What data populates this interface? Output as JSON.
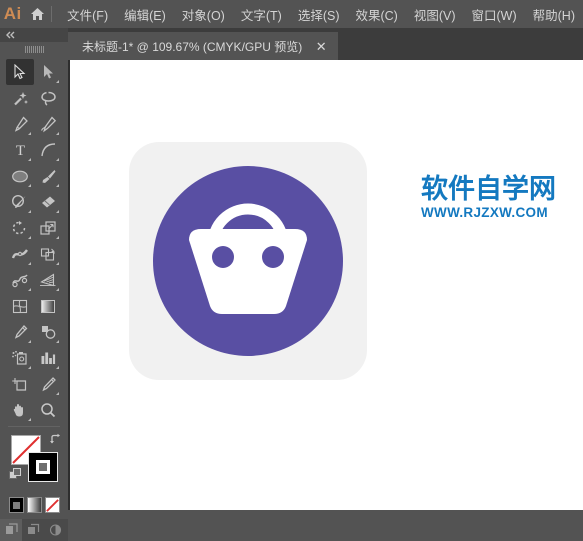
{
  "app": {
    "logo_text": "Ai",
    "home_icon": "home-icon",
    "accent_orange": "#cf8c54",
    "chrome_bg": "#535353"
  },
  "menubar": {
    "items": [
      {
        "label": "文件(F)",
        "name": "menu-file"
      },
      {
        "label": "编辑(E)",
        "name": "menu-edit"
      },
      {
        "label": "对象(O)",
        "name": "menu-object"
      },
      {
        "label": "文字(T)",
        "name": "menu-type"
      },
      {
        "label": "选择(S)",
        "name": "menu-select"
      },
      {
        "label": "效果(C)",
        "name": "menu-effect"
      },
      {
        "label": "视图(V)",
        "name": "menu-view"
      },
      {
        "label": "窗口(W)",
        "name": "menu-window"
      },
      {
        "label": "帮助(H)",
        "name": "menu-help"
      }
    ]
  },
  "tabbar": {
    "tab_title": "未标题-1* @ 109.67% (CMYK/GPU 预览)",
    "close_label": "✕",
    "document_name": "未标题-1",
    "modified_marker": "*",
    "zoom_level": "109.67%",
    "color_mode": "CMYK",
    "renderer": "GPU",
    "view_mode": "预览"
  },
  "toolbar": {
    "collapse_label": "◄◄",
    "tools": [
      {
        "name": "selection-tool",
        "label": "选择工具",
        "active": true,
        "corner": false
      },
      {
        "name": "direct-selection-tool",
        "label": "直接选择工具",
        "active": false,
        "corner": true
      },
      {
        "name": "magic-wand-tool",
        "label": "魔棒工具",
        "active": false,
        "corner": false
      },
      {
        "name": "lasso-tool",
        "label": "套索工具",
        "active": false,
        "corner": false
      },
      {
        "name": "pen-tool",
        "label": "钢笔工具",
        "active": false,
        "corner": true
      },
      {
        "name": "curvature-tool",
        "label": "曲率工具",
        "active": false,
        "corner": true
      },
      {
        "name": "type-tool",
        "label": "文字工具",
        "active": false,
        "corner": true
      },
      {
        "name": "line-segment-tool",
        "label": "直线段工具",
        "active": false,
        "corner": true
      },
      {
        "name": "ellipse-tool",
        "label": "椭圆工具",
        "active": false,
        "corner": true
      },
      {
        "name": "paintbrush-tool",
        "label": "画笔工具",
        "active": false,
        "corner": true
      },
      {
        "name": "shaper-tool",
        "label": "Shaper 工具",
        "active": false,
        "corner": true
      },
      {
        "name": "eraser-tool",
        "label": "橡皮擦工具",
        "active": false,
        "corner": true
      },
      {
        "name": "rotate-tool",
        "label": "旋转工具",
        "active": false,
        "corner": true
      },
      {
        "name": "scale-tool",
        "label": "比例缩放工具",
        "active": false,
        "corner": true
      },
      {
        "name": "width-tool",
        "label": "宽度工具",
        "active": false,
        "corner": true
      },
      {
        "name": "free-transform-tool",
        "label": "自由变换工具",
        "active": false,
        "corner": true
      },
      {
        "name": "shape-builder-tool",
        "label": "形状生成器工具",
        "active": false,
        "corner": true
      },
      {
        "name": "perspective-grid-tool",
        "label": "透视网格工具",
        "active": false,
        "corner": true
      },
      {
        "name": "mesh-tool",
        "label": "网格工具",
        "active": false,
        "corner": false
      },
      {
        "name": "gradient-tool",
        "label": "渐变工具",
        "active": false,
        "corner": false
      },
      {
        "name": "eyedropper-tool",
        "label": "吸管工具",
        "active": false,
        "corner": true
      },
      {
        "name": "blend-tool",
        "label": "混合工具",
        "active": false,
        "corner": true
      },
      {
        "name": "symbol-sprayer-tool",
        "label": "符号喷枪工具",
        "active": false,
        "corner": true
      },
      {
        "name": "column-graph-tool",
        "label": "柱形图工具",
        "active": false,
        "corner": true
      },
      {
        "name": "artboard-tool",
        "label": "画板工具",
        "active": false,
        "corner": false
      },
      {
        "name": "slice-tool",
        "label": "切片工具",
        "active": false,
        "corner": true
      },
      {
        "name": "hand-tool",
        "label": "抓手工具",
        "active": false,
        "corner": true
      },
      {
        "name": "zoom-tool",
        "label": "缩放工具",
        "active": false,
        "corner": false
      }
    ],
    "color_controls": {
      "fill_label": "填色",
      "fill_color": "#ffffff",
      "fill_is_none": true,
      "stroke_label": "描边",
      "stroke_color": "#000000",
      "swap_label": "互换填色和描边",
      "default_label": "默认填色和描边"
    },
    "mode_buttons": [
      {
        "name": "color-mode-button",
        "label": "颜色"
      },
      {
        "name": "gradient-mode-button",
        "label": "渐变"
      },
      {
        "name": "none-mode-button",
        "label": "无"
      }
    ],
    "screen_buttons": [
      {
        "name": "screen-mode-normal-button",
        "label": "正常屏幕模式"
      },
      {
        "name": "screen-mode-fullscreen-menubar-button",
        "label": "带有菜单栏的全屏模式"
      },
      {
        "name": "screen-mode-fullscreen-button",
        "label": "全屏模式"
      }
    ]
  },
  "canvas": {
    "background": "#ffffff",
    "artboard": {
      "name": "artboard-shape",
      "fill": "#f1f1f1",
      "corner_radius": 30
    },
    "artwork": {
      "name": "shopping-bag-icon",
      "circle_fill": "#594fa3",
      "bag_fill": "#ffffff",
      "dot_fill": "#594fa3",
      "description": "紫色圆形购物袋图标"
    }
  },
  "watermark": {
    "cn_text": "软件自学网",
    "en_text": "WWW.RJZXW.COM",
    "color": "#1479c0"
  }
}
